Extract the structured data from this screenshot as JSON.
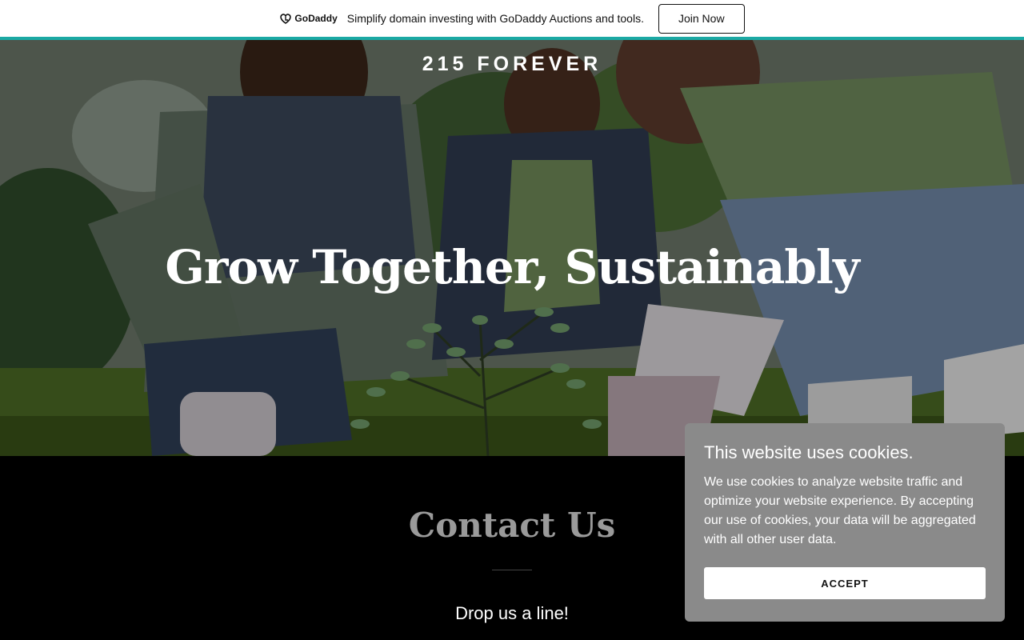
{
  "promo": {
    "logo_text": "GoDaddy",
    "logo_icon": "godaddy-logo-icon",
    "text": "Simplify domain investing with GoDaddy Auctions and tools.",
    "button_label": "Join Now",
    "accent_color": "#1ba9a4"
  },
  "hero": {
    "site_name": "215 FOREVER",
    "title": "Grow Together, Sustainably"
  },
  "contact": {
    "title": "Contact Us",
    "subtitle": "Drop us a line!"
  },
  "cookie": {
    "title": "This website uses cookies.",
    "body": "We use cookies to analyze website traffic and optimize your website experience. By accepting our use of cookies, your data will be aggregated with all other user data.",
    "accept_label": "ACCEPT"
  }
}
